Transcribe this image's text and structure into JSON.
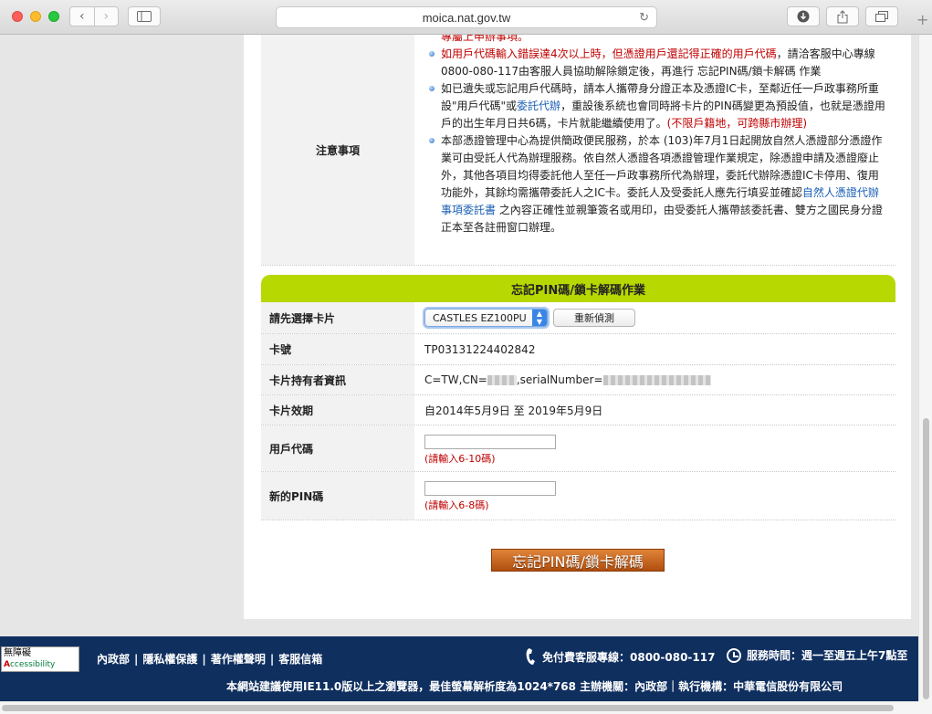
{
  "browser": {
    "url": "moica.nat.gov.tw",
    "back": "‹",
    "forward": "›"
  },
  "notice": {
    "label": "注意事項",
    "cutoff": "專屬上申辦事項。",
    "items": [
      {
        "parts": [
          {
            "t": "如用戶代碼輸入錯誤達4次以上時，但憑證用戶還記得正確的用戶代碼",
            "c": "red"
          },
          {
            "t": "，請洽客服中心專線0800-080-117由客服人員協助解除鎖定後，再進行 忘記PIN碼/鎖卡解碼 作業",
            "c": ""
          }
        ]
      },
      {
        "parts": [
          {
            "t": "如已遺失或忘記用戶代碼時，請本人攜帶身分證正本及憑證IC卡，至鄰近任一戶政事務所重設\"用戶代碼\"或",
            "c": ""
          },
          {
            "t": "委託代辦",
            "c": "blue"
          },
          {
            "t": "，重設後系統也會同時將卡片的PIN碼變更為預設值，也就是憑證用戶的出生年月日共6碼，卡片就能繼續使用了。",
            "c": ""
          },
          {
            "t": "(不限戶籍地，可跨縣市辦理)",
            "c": "red"
          }
        ]
      },
      {
        "parts": [
          {
            "t": "本部憑證管理中心為提供簡政便民服務，於本 (103)年7月1日起開放自然人憑證部分憑證作業可由受託人代為辦理服務。依自然人憑證各項憑證管理作業規定，除憑證申請及憑證廢止外，其他各項目均得委託他人至任一戶政事務所代為辦理，委託代辦除憑證IC卡停用、復用功能外，其餘均需攜帶委託人之IC卡。委託人及受委託人應先行填妥並確認",
            "c": ""
          },
          {
            "t": "自然人憑證代辦事項委託書",
            "c": "blue"
          },
          {
            "t": " 之內容正確性並親筆簽名或用印，由受委託人攜帶該委託書、雙方之國民身分證正本至各註冊窗口辦理。",
            "c": ""
          }
        ]
      }
    ]
  },
  "section": {
    "title": "忘記PIN碼/鎖卡解碼作業",
    "rows": {
      "card_select_label": "請先選擇卡片",
      "card_select_value": "CASTLES EZ100PU",
      "redetect_label": "重新偵測",
      "card_no_label": "卡號",
      "card_no_value": "TP03131224402842",
      "holder_label": "卡片持有者資訊",
      "holder_prefix": "C=TW,CN=",
      "holder_mid": ",serialNumber=",
      "validity_label": "卡片效期",
      "validity_value": "自2014年5月9日 至 2019年5月9日",
      "user_code_label": "用戶代碼",
      "user_code_hint": "(請輸入6-10碼)",
      "new_pin_label": "新的PIN碼",
      "new_pin_hint": "(請輸入6-8碼)"
    },
    "submit_label": "忘記PIN碼/鎖卡解碼"
  },
  "footer": {
    "logo_line1": "無障礙",
    "logo_line2": "ccessibility",
    "logo_A": "A",
    "links": [
      "內政部",
      "隱私權保護",
      "著作權聲明",
      "客服信箱"
    ],
    "hotline": "免付費客服專線：0800-080-117",
    "service_hours": "服務時間：週一至週五上午7點至",
    "note": "本網站建議使用IE11.0版以上之瀏覽器，最佳螢幕解析度為1024*768 主辦機關：內政部｜執行機構：中華電信股份有限公司"
  },
  "colors": {
    "section_header": "#b7d800",
    "footer_bg": "#0f2f5f",
    "submit_button": "#c8621f",
    "warning_text": "#c00000",
    "link_text": "#1a5fb4"
  },
  "icons": {
    "reload": "reload-icon",
    "download": "download-icon",
    "share": "share-icon",
    "tabs": "tabs-icon",
    "phone": "phone-icon",
    "clock": "clock-icon"
  }
}
